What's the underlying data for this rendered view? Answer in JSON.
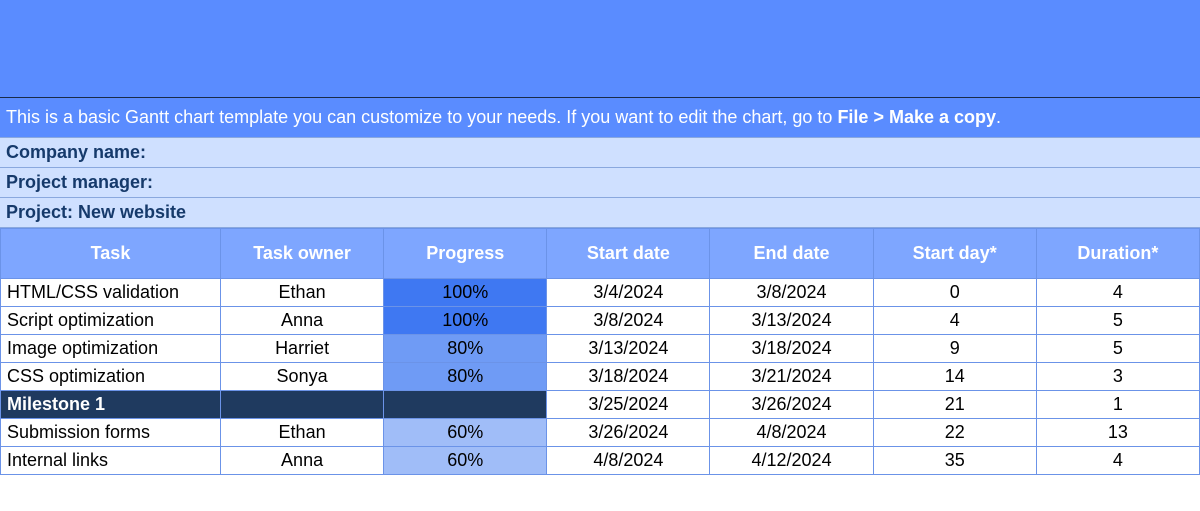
{
  "instruction": {
    "prefix": "This is a basic Gantt chart template you can customize to your needs. If you want to edit the chart, go to ",
    "bold": "File > Make a copy",
    "suffix": "."
  },
  "meta": {
    "company_label": "Company name:",
    "manager_label": "Project manager:",
    "project_label": "Project: New website"
  },
  "headers": {
    "task": "Task",
    "owner": "Task owner",
    "progress": "Progress",
    "start": "Start date",
    "end": "End date",
    "start_day": "Start day*",
    "duration": "Duration*"
  },
  "rows": [
    {
      "task": "HTML/CSS validation",
      "owner": "Ethan",
      "progress": "100%",
      "progress_level": "100",
      "start": "3/4/2024",
      "end": "3/8/2024",
      "start_day": "0",
      "duration": "4",
      "milestone": false
    },
    {
      "task": "Script optimization",
      "owner": "Anna",
      "progress": "100%",
      "progress_level": "100",
      "start": "3/8/2024",
      "end": "3/13/2024",
      "start_day": "4",
      "duration": "5",
      "milestone": false
    },
    {
      "task": "Image optimization",
      "owner": "Harriet",
      "progress": "80%",
      "progress_level": "80",
      "start": "3/13/2024",
      "end": "3/18/2024",
      "start_day": "9",
      "duration": "5",
      "milestone": false
    },
    {
      "task": "CSS optimization",
      "owner": "Sonya",
      "progress": "80%",
      "progress_level": "80",
      "start": "3/18/2024",
      "end": "3/21/2024",
      "start_day": "14",
      "duration": "3",
      "milestone": false
    },
    {
      "task": "Milestone 1",
      "owner": "",
      "progress": "",
      "progress_level": "",
      "start": "3/25/2024",
      "end": "3/26/2024",
      "start_day": "21",
      "duration": "1",
      "milestone": true
    },
    {
      "task": "Submission forms",
      "owner": "Ethan",
      "progress": "60%",
      "progress_level": "60",
      "start": "3/26/2024",
      "end": "4/8/2024",
      "start_day": "22",
      "duration": "13",
      "milestone": false
    },
    {
      "task": "Internal links",
      "owner": "Anna",
      "progress": "60%",
      "progress_level": "60",
      "start": "4/8/2024",
      "end": "4/12/2024",
      "start_day": "35",
      "duration": "4",
      "milestone": false
    }
  ],
  "chart_data": {
    "type": "table",
    "title": "Project: New website",
    "columns": [
      "Task",
      "Task owner",
      "Progress",
      "Start date",
      "End date",
      "Start day*",
      "Duration*"
    ],
    "rows": [
      [
        "HTML/CSS validation",
        "Ethan",
        "100%",
        "3/4/2024",
        "3/8/2024",
        0,
        4
      ],
      [
        "Script optimization",
        "Anna",
        "100%",
        "3/8/2024",
        "3/13/2024",
        4,
        5
      ],
      [
        "Image optimization",
        "Harriet",
        "80%",
        "3/13/2024",
        "3/18/2024",
        9,
        5
      ],
      [
        "CSS optimization",
        "Sonya",
        "80%",
        "3/18/2024",
        "3/21/2024",
        14,
        3
      ],
      [
        "Milestone 1",
        "",
        "",
        "3/25/2024",
        "3/26/2024",
        21,
        1
      ],
      [
        "Submission forms",
        "Ethan",
        "60%",
        "3/26/2024",
        "4/8/2024",
        22,
        13
      ],
      [
        "Internal links",
        "Anna",
        "60%",
        "4/8/2024",
        "4/12/2024",
        35,
        4
      ]
    ]
  }
}
